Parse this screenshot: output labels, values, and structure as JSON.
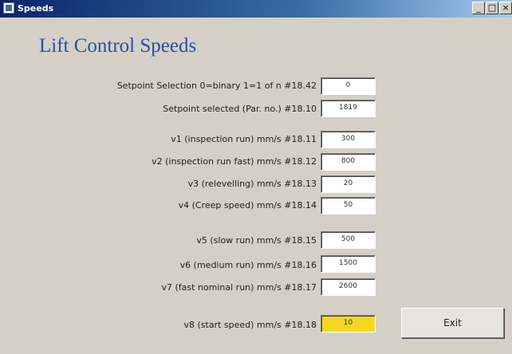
{
  "window": {
    "title": "Speeds",
    "controls": {
      "minimize": "_",
      "maximize": "□",
      "close": "×"
    }
  },
  "heading": "Lift Control Speeds",
  "rows": [
    {
      "label": "Setpoint Selection 0=binary 1=1 of n #18.42",
      "value": "0"
    },
    {
      "label": "Setpoint selected (Par. no.) #18.10",
      "value": "1819"
    },
    {
      "label": "v1 (inspection run) mm/s #18.11",
      "value": "300"
    },
    {
      "label": "v2 (inspection run fast) mm/s #18.12",
      "value": "800"
    },
    {
      "label": "v3 (relevelling) mm/s #18.13",
      "value": "20"
    },
    {
      "label": "v4 (Creep speed) mm/s #18.14",
      "value": "50"
    },
    {
      "label": "v5 (slow run) mm/s #18.15",
      "value": "500"
    },
    {
      "label": "v6 (medium run) mm/s #18.16",
      "value": "1500"
    },
    {
      "label": "v7 (fast nominal run) mm/s #18.17",
      "value": "2600"
    },
    {
      "label": "v8 (start speed) mm/s #18.18",
      "value": "10",
      "highlight": "#f4d820"
    }
  ],
  "exit_label": "Exit"
}
